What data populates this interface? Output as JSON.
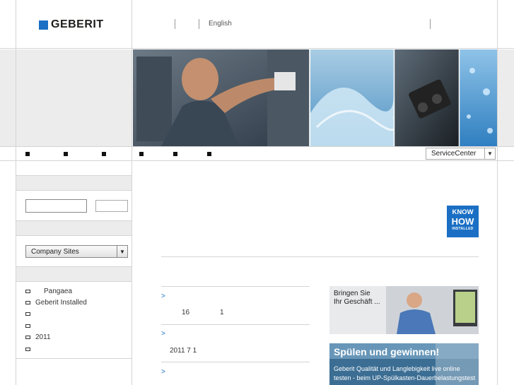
{
  "header": {
    "logo_text": "GEBERIT",
    "language_link": "English"
  },
  "nav": {
    "service_center_select": "ServiceCenter"
  },
  "sidebar": {
    "company_sites_select": "Company Sites",
    "links": [
      {
        "label": "Pangaea",
        "indent": true
      },
      {
        "label": "Geberit Installed",
        "indent": false
      },
      {
        "label": "",
        "indent": false
      },
      {
        "label": "",
        "indent": false
      },
      {
        "label": "2011",
        "indent": false
      },
      {
        "label": "",
        "indent": false
      }
    ]
  },
  "main": {
    "know_how_badge": {
      "line1": "KNOW",
      "line2": "HOW",
      "line3": "INSTALLED"
    },
    "news": [
      {
        "arrow": ">",
        "text_a": "16",
        "text_b": "1"
      },
      {
        "arrow": ">",
        "text_a": "2011 7 1",
        "text_b": ""
      },
      {
        "arrow": ">",
        "text_a": "",
        "text_b": ""
      }
    ],
    "ads": {
      "ad1": {
        "line1": "Bringen Sie",
        "line2": "Ihr Geschäft ..."
      },
      "ad2": {
        "title": "Spülen und gewinnen!",
        "line1": "Geberit Qualität und Langlebigkeit live online",
        "line2": "testen - beim UP-Spülkasten-Dauerbelastungstest"
      }
    }
  },
  "colors": {
    "brand_blue": "#1a6fc4",
    "sidebar_grey": "#ececec",
    "border_grey": "#d4d4d4"
  }
}
